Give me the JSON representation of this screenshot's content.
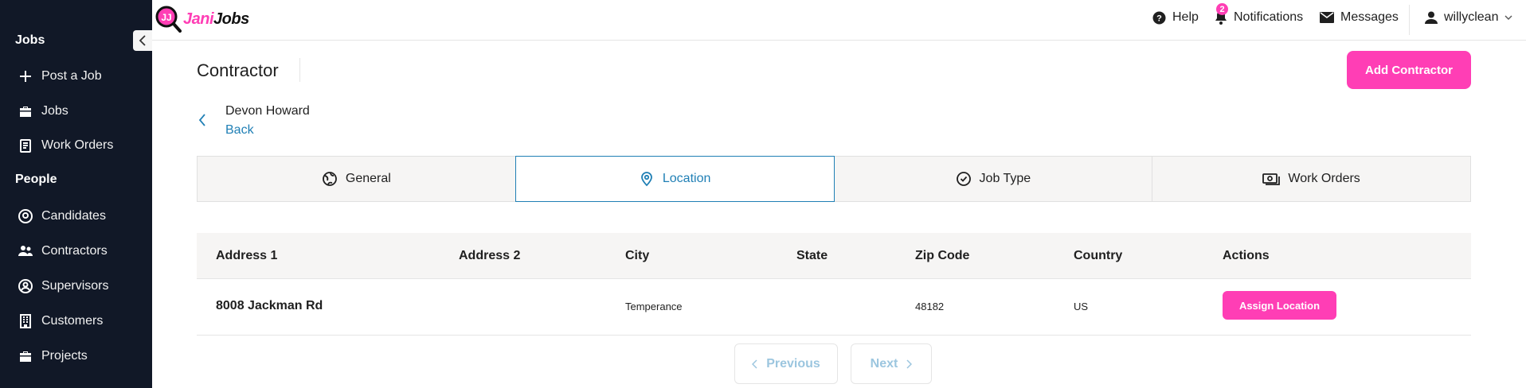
{
  "brand": {
    "name_part1": "Jani",
    "name_part2": "Jobs",
    "accent": "#ff3eb5",
    "sidebar_bg": "#111827",
    "link_color": "#1f7fb5"
  },
  "sidebar": {
    "sections": [
      {
        "title": "Jobs",
        "items": [
          {
            "label": "Post a Job",
            "icon": "plus-icon"
          },
          {
            "label": "Jobs",
            "icon": "briefcase-icon"
          },
          {
            "label": "Work Orders",
            "icon": "clipboard-icon"
          }
        ]
      },
      {
        "title": "People",
        "items": [
          {
            "label": "Candidates",
            "icon": "search-person-icon"
          },
          {
            "label": "Contractors",
            "icon": "users-icon"
          },
          {
            "label": "Supervisors",
            "icon": "user-circle-icon"
          },
          {
            "label": "Customers",
            "icon": "building-icon"
          },
          {
            "label": "Projects",
            "icon": "briefcase-icon"
          }
        ]
      }
    ]
  },
  "header": {
    "help": "Help",
    "notifications": "Notifications",
    "notification_count": "2",
    "messages": "Messages",
    "username": "willyclean"
  },
  "page": {
    "title": "Contractor",
    "add_button": "Add Contractor",
    "person_name": "Devon Howard",
    "back_label": "Back"
  },
  "tabs": [
    {
      "label": "General",
      "icon": "globe-icon",
      "active": false
    },
    {
      "label": "Location",
      "icon": "map-pin-icon",
      "active": true
    },
    {
      "label": "Job Type",
      "icon": "check-circle-icon",
      "active": false
    },
    {
      "label": "Work Orders",
      "icon": "money-icon",
      "active": false
    }
  ],
  "table": {
    "columns": [
      "Address 1",
      "Address 2",
      "City",
      "State",
      "Zip Code",
      "Country",
      "Actions"
    ],
    "rows": [
      {
        "address1": "8008 Jackman Rd",
        "address2": "",
        "city": "Temperance",
        "state": "",
        "zip": "48182",
        "country": "US",
        "action": "Assign Location"
      }
    ]
  },
  "pagination": {
    "previous": "Previous",
    "next": "Next"
  }
}
